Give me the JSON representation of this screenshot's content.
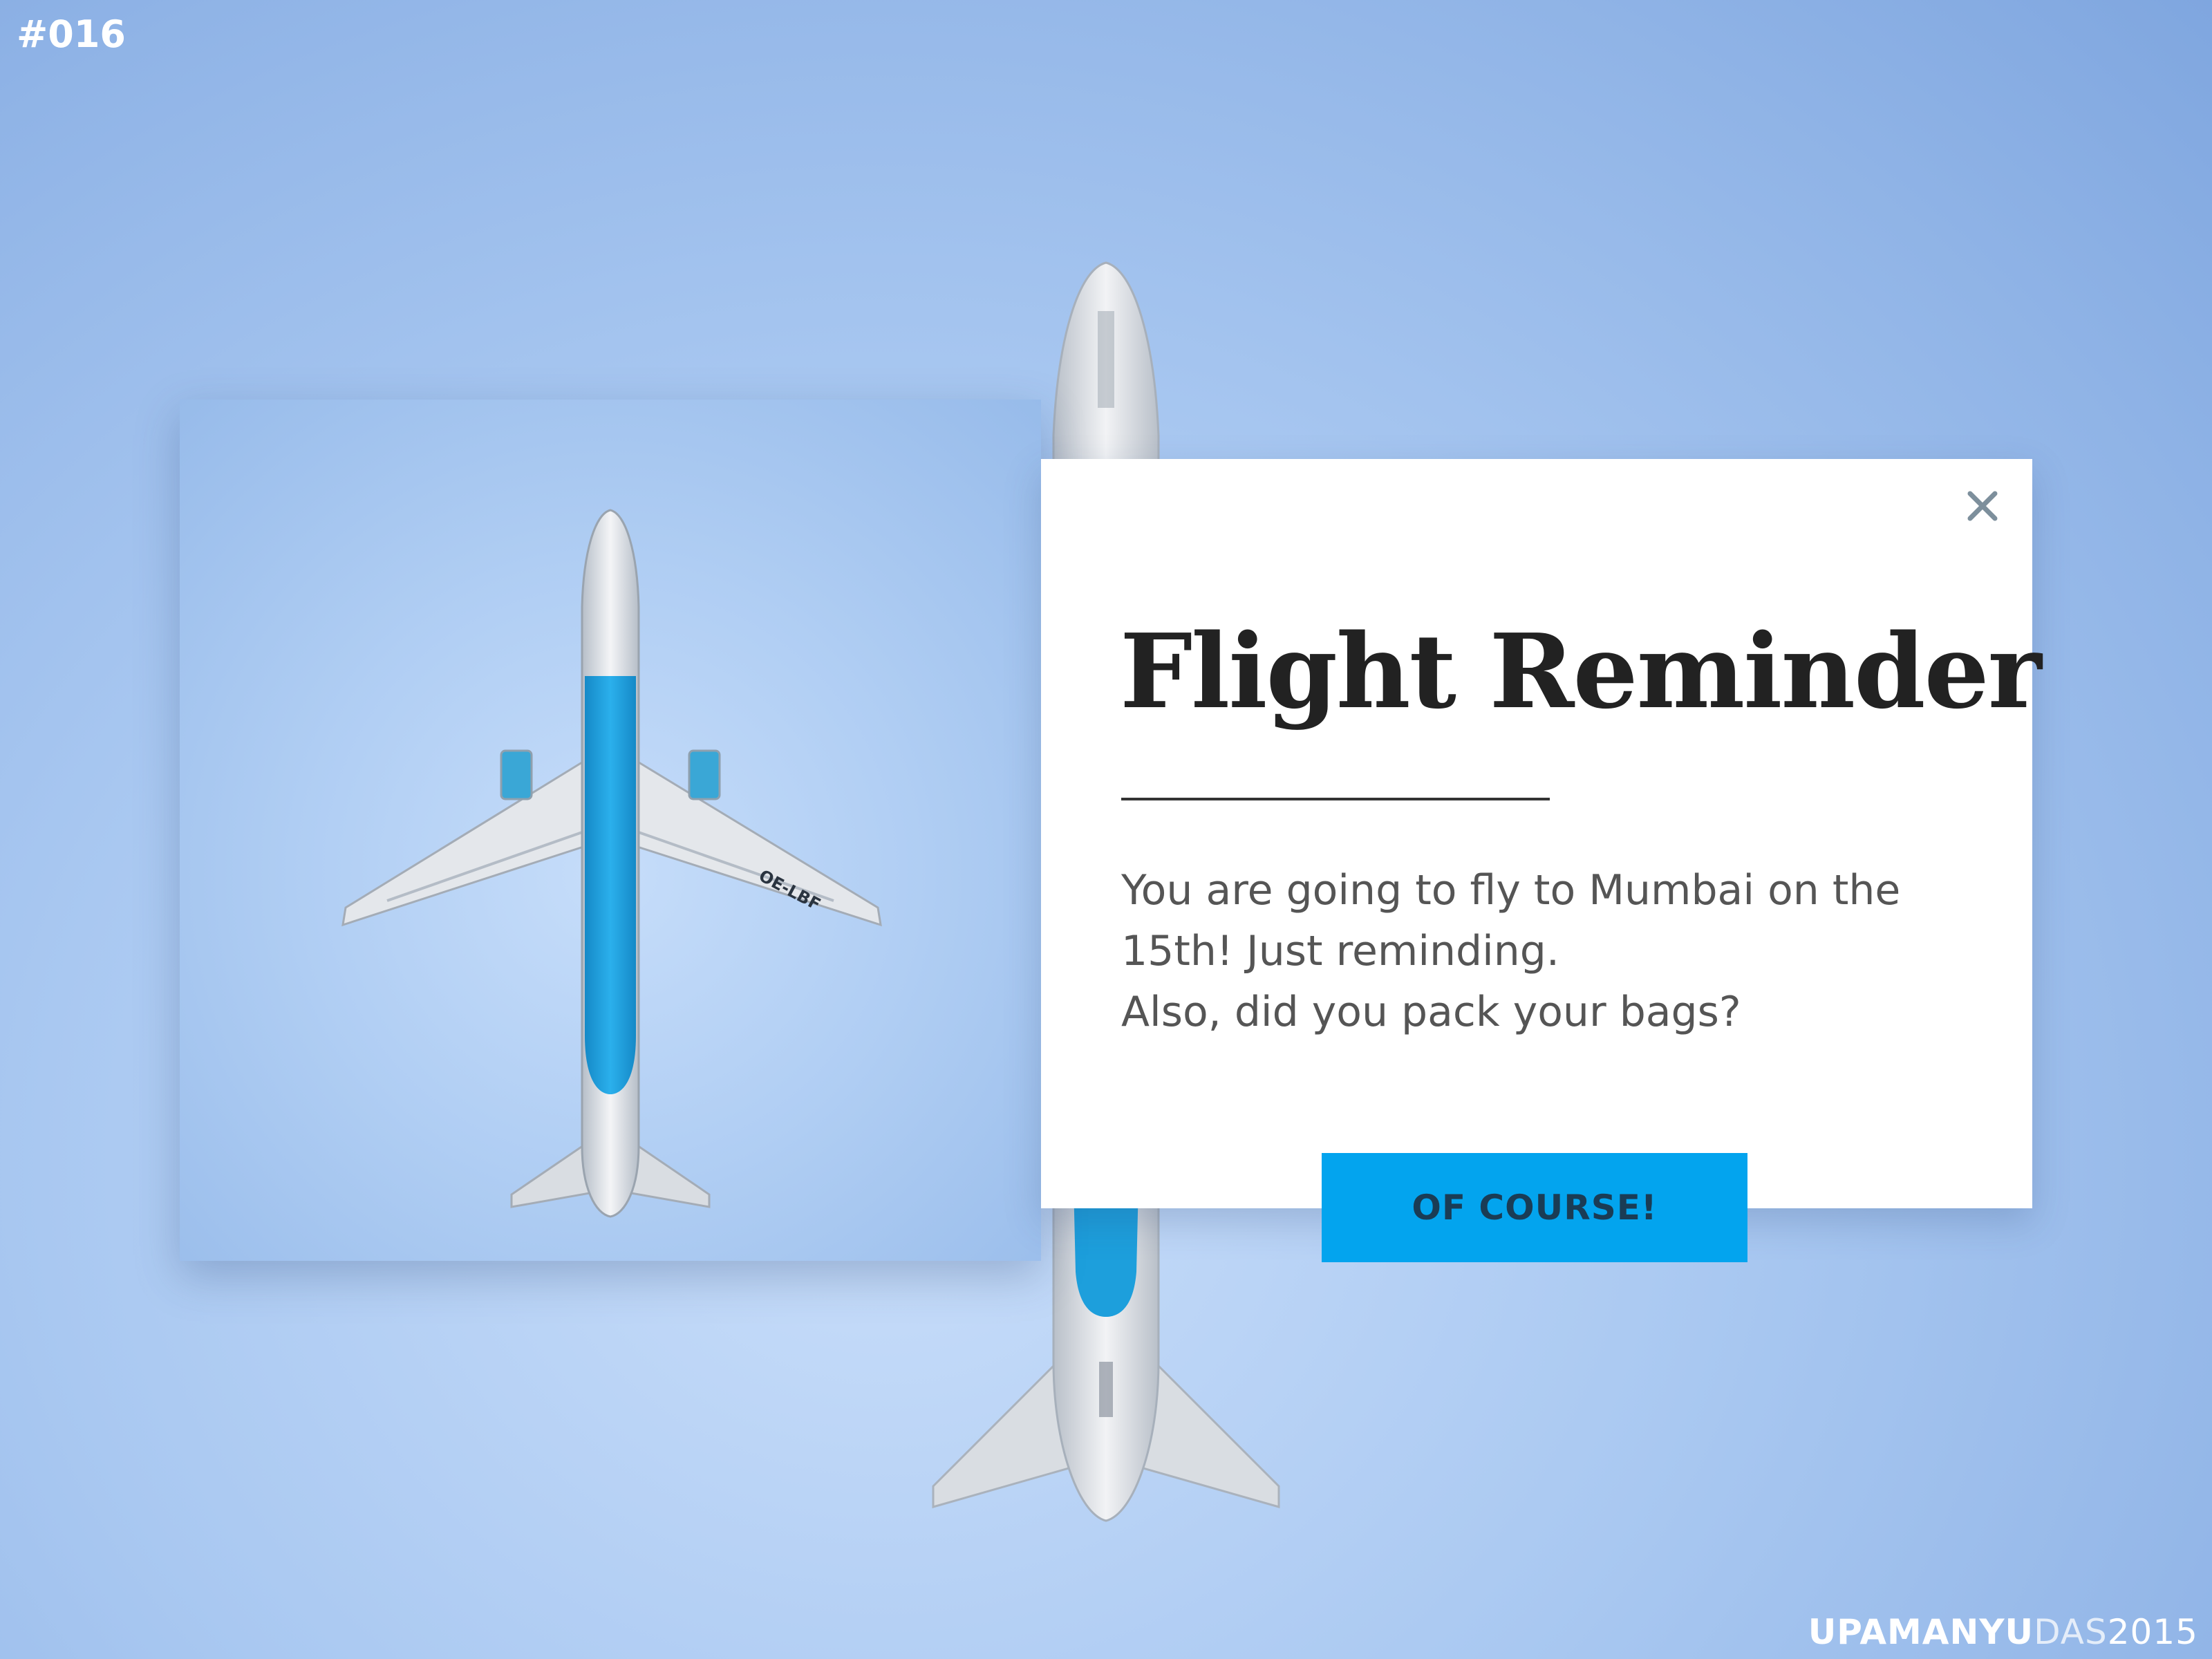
{
  "slide": {
    "number": "#016",
    "signature": {
      "first": "UPAMANYU",
      "last": "DAS",
      "year": "2015"
    }
  },
  "photo": {
    "plane_livery": "OE-LBF",
    "colors": {
      "sky": "#b3d0f5",
      "fuselage": "#e8eaee",
      "accent": "#1d9fdc"
    }
  },
  "dialog": {
    "title": "Flight Reminder",
    "body_line_1": "You are going to fly to Mumbai on the 15th! Just reminding.",
    "body_line_2": "Also, did you pack your bags?",
    "close_icon": "close-icon",
    "confirm_label": "OF COURSE!"
  },
  "colors": {
    "button": "#03a4ee",
    "button_text": "#1a3c55",
    "title_text": "#222222",
    "body_text": "#555555",
    "close_icon": "#7d8f9c"
  }
}
